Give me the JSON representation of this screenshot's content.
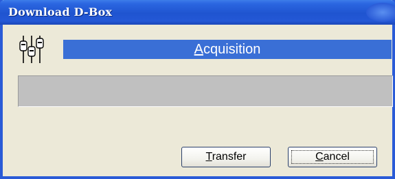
{
  "window": {
    "title": "Download D-Box"
  },
  "header": {
    "accel": "A",
    "rest": "cquisition"
  },
  "progress": {
    "value": 0
  },
  "buttons": {
    "transfer": {
      "accel": "T",
      "rest": "ransfer"
    },
    "cancel": {
      "accel": "C",
      "rest": "ancel"
    }
  },
  "icons": {
    "app": "sliders-icon"
  },
  "colors": {
    "titlebar": "#2458d6",
    "header": "#3a6fd6",
    "progress_track": "#c0c0c0",
    "dialog_bg": "#ece9d8"
  }
}
